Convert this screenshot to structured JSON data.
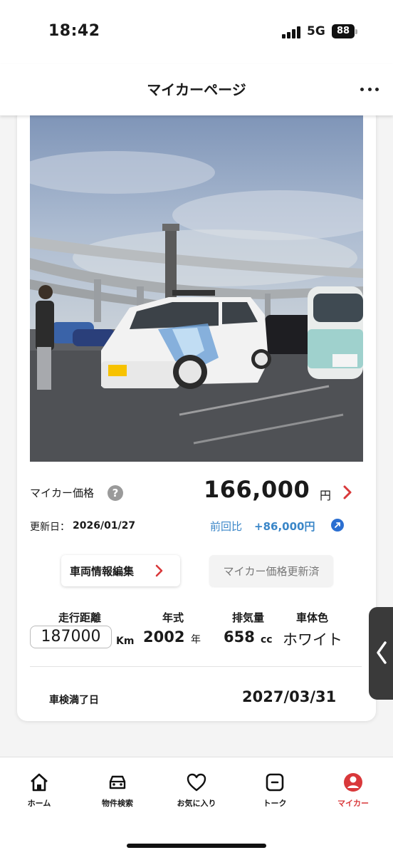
{
  "status": {
    "time": "18:42",
    "network": "5G",
    "battery": "88"
  },
  "header": {
    "title": "マイカーページ"
  },
  "price": {
    "label": "マイカー価格",
    "help": "?",
    "value": "166,000",
    "unit": "円",
    "update_label": "更新日：",
    "update_date": "2026/01/27",
    "prev_label": "前回比",
    "prev_value": "+86,000円"
  },
  "buttons": {
    "edit": "車両情報編集",
    "updated": "マイカー価格更新済"
  },
  "specs": {
    "mileage_label": "走行距離",
    "mileage": "187000",
    "mileage_unit": "Km",
    "year_label": "年式",
    "year": "2002",
    "year_unit": "年",
    "disp_label": "排気量",
    "disp": "658",
    "disp_unit": "cc",
    "color_label": "車体色",
    "color": "ホワイト"
  },
  "inspection": {
    "label": "車検満了日",
    "date": "2027/03/31"
  },
  "tabs": [
    {
      "label": "ホーム",
      "icon": "home-icon"
    },
    {
      "label": "物件検索",
      "icon": "car-icon"
    },
    {
      "label": "お気に入り",
      "icon": "heart-icon"
    },
    {
      "label": "トーク",
      "icon": "chat-icon"
    },
    {
      "label": "マイカー",
      "icon": "user-icon"
    }
  ],
  "colors": {
    "accent": "#d9383a",
    "link": "#3a86c8",
    "link_icon": "#2b6fd1"
  }
}
